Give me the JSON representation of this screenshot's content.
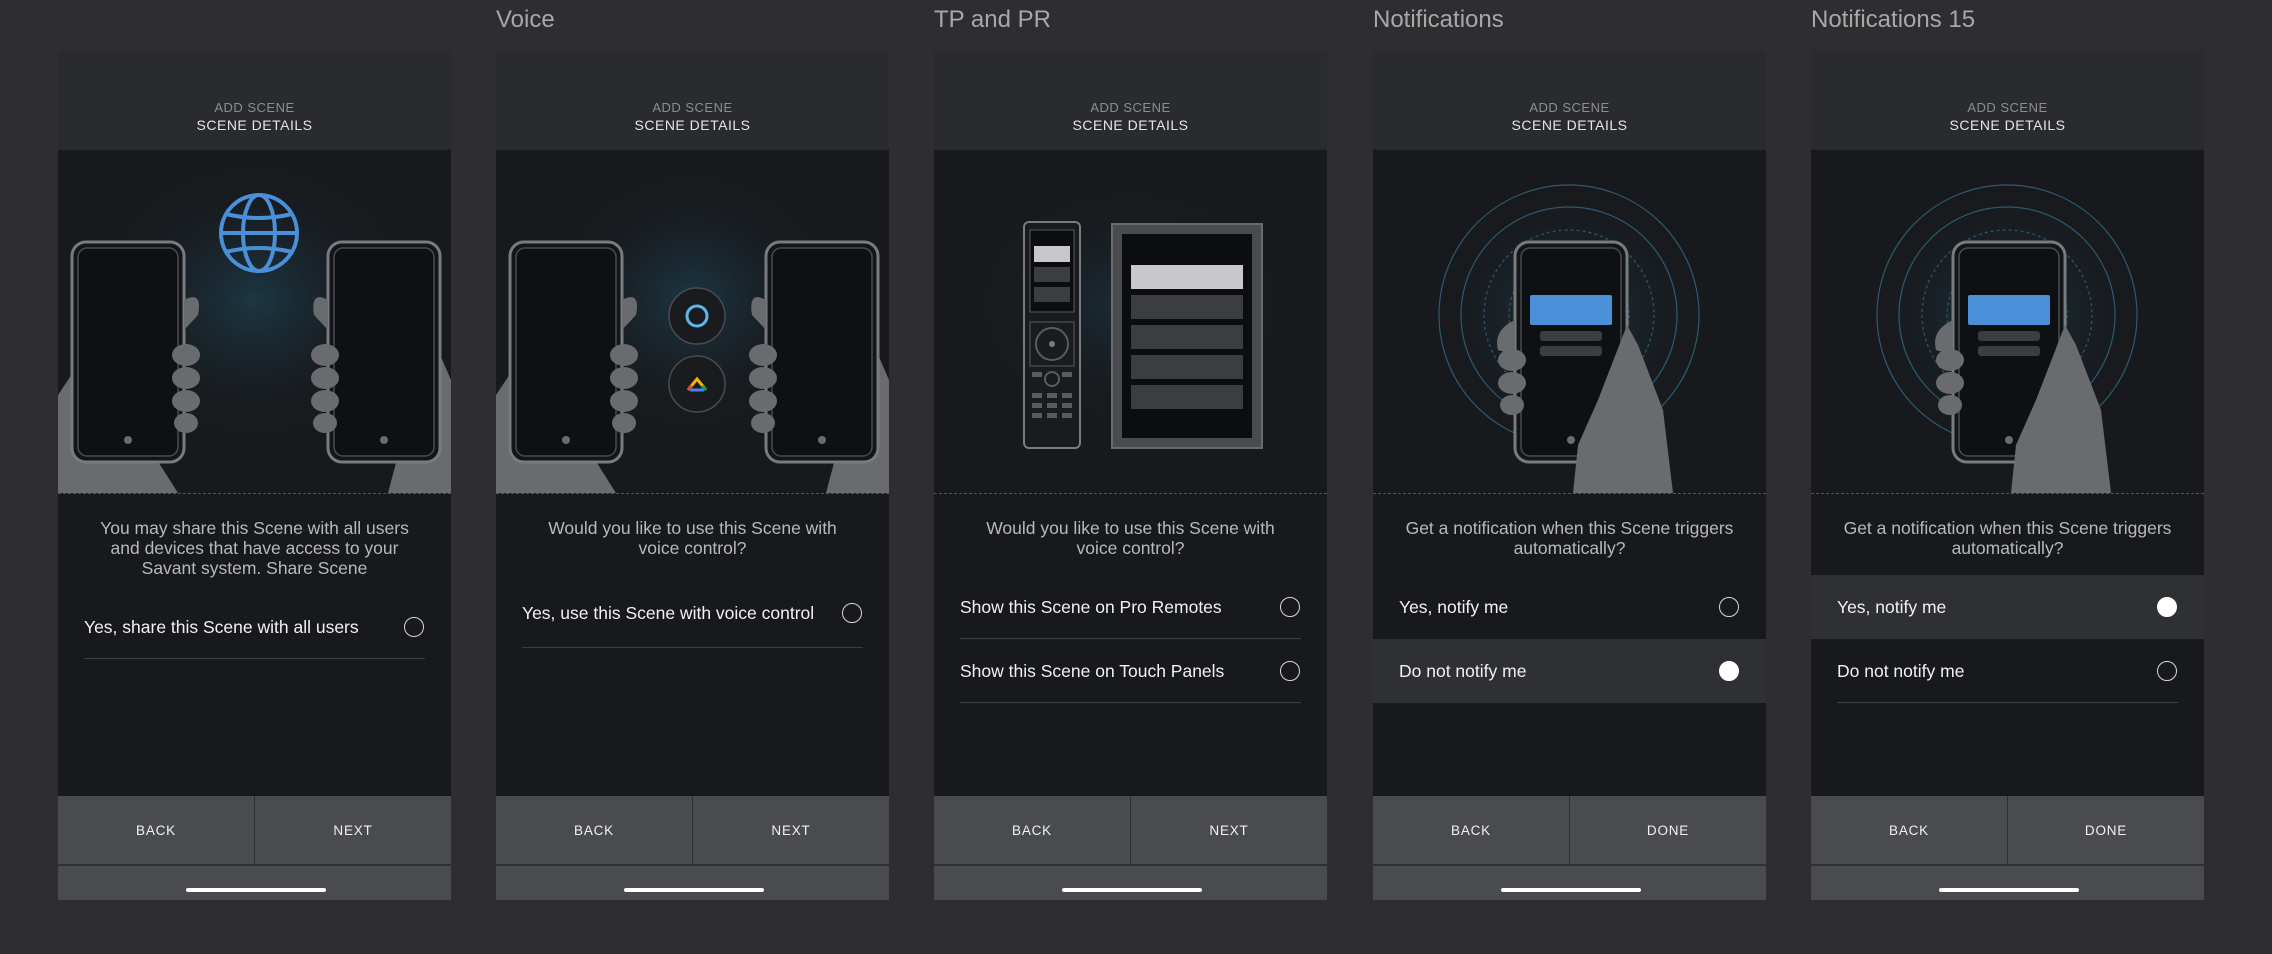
{
  "frames": [
    {
      "label": "",
      "header_sub": "ADD SCENE",
      "header_title": "SCENE DETAILS",
      "question": "You may share this Scene with all users and devices that have access to your Savant system. Share Scene",
      "illustration": "two-phones-globe-icon",
      "options": [
        {
          "label": "Yes, share this Scene with all users",
          "selected": false
        }
      ],
      "back_label": "BACK",
      "next_label": "NEXT"
    },
    {
      "label": "Voice",
      "header_sub": "ADD SCENE",
      "header_title": "SCENE DETAILS",
      "question": "Would you like to use this Scene with voice control?",
      "illustration": "two-phones-voice-assistant-icons",
      "options": [
        {
          "label": "Yes, use this Scene with voice control",
          "selected": false
        }
      ],
      "back_label": "BACK",
      "next_label": "NEXT"
    },
    {
      "label": "TP and PR",
      "header_sub": "ADD SCENE",
      "header_title": "SCENE DETAILS",
      "question": "Would you like to use this Scene with voice control?",
      "illustration": "remote-and-touch-panel-icon",
      "options": [
        {
          "label": "Show this Scene on Pro Remotes",
          "selected": false
        },
        {
          "label": "Show this Scene on Touch Panels",
          "selected": false
        }
      ],
      "back_label": "BACK",
      "next_label": "NEXT"
    },
    {
      "label": "Notifications",
      "header_sub": "ADD SCENE",
      "header_title": "SCENE DETAILS",
      "question": "Get a notification when this Scene triggers automatically?",
      "illustration": "phone-notification-icon",
      "options": [
        {
          "label": "Yes, notify me",
          "selected": false
        },
        {
          "label": "Do not notify me",
          "selected": true
        }
      ],
      "back_label": "BACK",
      "next_label": "DONE"
    },
    {
      "label": "Notifications 15",
      "header_sub": "ADD SCENE",
      "header_title": "SCENE DETAILS",
      "question": "Get a notification when this Scene triggers automatically?",
      "illustration": "phone-notification-icon",
      "options": [
        {
          "label": "Yes, notify me",
          "selected": true
        },
        {
          "label": "Do not notify me",
          "selected": false
        }
      ],
      "back_label": "BACK",
      "next_label": "DONE"
    }
  ],
  "colors": {
    "background": "#2e2e30",
    "panel": "#18191c",
    "header": "#2a2b2e",
    "footer": "#4a4b4e",
    "accent_blue": "#4a90d9"
  }
}
